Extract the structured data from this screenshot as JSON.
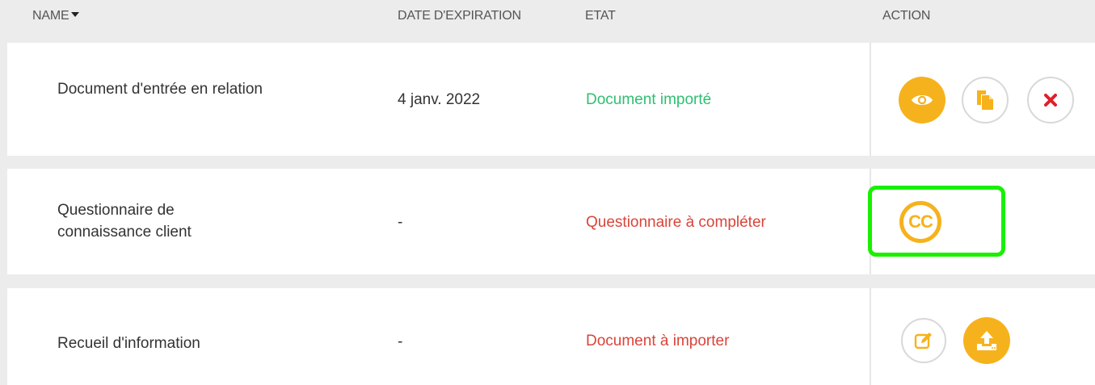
{
  "header": {
    "name": "NAME",
    "date": "DATE D'EXPIRATION",
    "etat": "ETAT",
    "action": "ACTION"
  },
  "rows": [
    {
      "name": "Document d'entrée en relation",
      "date": "4 janv. 2022",
      "etat": "Document importé",
      "etat_color": "#2fbf71",
      "actions": [
        "view-icon",
        "copy-icon",
        "delete-icon"
      ]
    },
    {
      "name": "Questionnaire de connaissance client",
      "date": "-",
      "etat": "Questionnaire à compléter",
      "etat_color": "#d9443a",
      "actions": [
        "cc-icon"
      ],
      "cc_label": "CC",
      "highlighted": true
    },
    {
      "name": "Recueil d'information",
      "date": "-",
      "etat": "Document à importer",
      "etat_color": "#d9443a",
      "actions": [
        "edit-icon",
        "upload-icon"
      ]
    }
  ],
  "colors": {
    "accent": "#f6b21d",
    "highlight": "#19f000",
    "delete": "#e0202a"
  }
}
